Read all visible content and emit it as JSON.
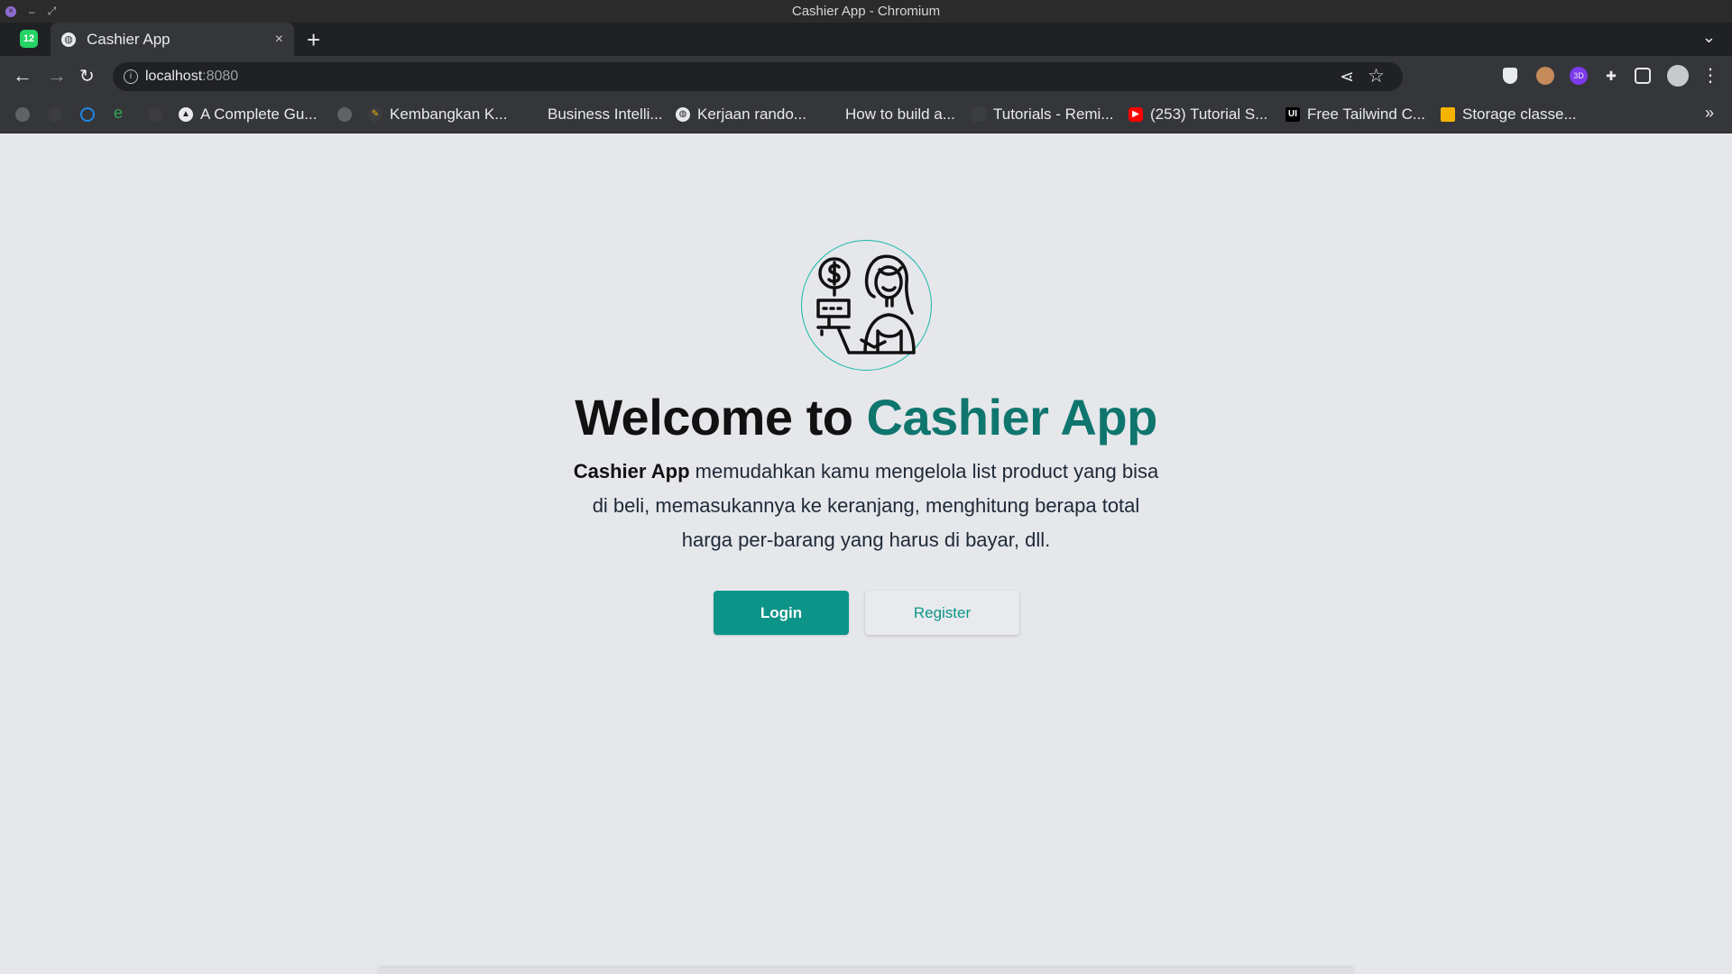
{
  "window": {
    "title": "Cashier App - Chromium"
  },
  "tab": {
    "title": "Cashier App",
    "app_badge": "12",
    "close": "×",
    "new_tab": "+"
  },
  "toolbar": {
    "url_host": "localhost",
    "url_port": ":8080",
    "info": "i"
  },
  "extensions": [
    "shield-icon",
    "cookie-icon",
    "3d-icon",
    "puzzle-icon",
    "sidepanel-icon",
    "profile-icon",
    "menu-icon"
  ],
  "bookmarks": [
    {
      "label": "A Complete Gu...",
      "icon": "mountain-icon",
      "color": "#e8eaed"
    },
    {
      "label": "Kembangkan K...",
      "icon": "feather-icon",
      "color": "#e8eaed"
    },
    {
      "label": "Business Intelli...",
      "icon": "none",
      "color": "#e8eaed"
    },
    {
      "label": "Kerjaan rando...",
      "icon": "globe-icon",
      "color": "#e8eaed"
    },
    {
      "label": "How to build a...",
      "icon": "none",
      "color": "#e8eaed"
    },
    {
      "label": "Tutorials - Remi...",
      "icon": "page-icon",
      "color": "#e8eaed"
    },
    {
      "label": "(253) Tutorial S...",
      "icon": "youtube-icon",
      "color": "#ff0000"
    },
    {
      "label": "Free Tailwind C...",
      "icon": "ui-icon",
      "color": "#ffffff"
    },
    {
      "label": "Storage classe...",
      "icon": "box-icon",
      "color": "#f5b400"
    }
  ],
  "page": {
    "headline_prefix": "Welcome to ",
    "headline_brand": "Cashier App",
    "desc_bold": "Cashier App",
    "desc_line1": " memudahkan kamu mengelola list product yang bisa",
    "desc_line2": "di beli, memasukannya ke keranjang, menghitung berapa total",
    "desc_line3": "harga per-barang yang harus di bayar, dll.",
    "login_label": "Login",
    "register_label": "Register"
  },
  "colors": {
    "accent": "#0d9488",
    "brand_text": "#0f766e",
    "page_bg": "#e5e7eb"
  }
}
